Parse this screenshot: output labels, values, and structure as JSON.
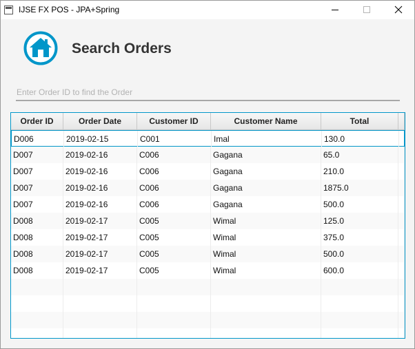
{
  "window": {
    "title": "IJSE FX POS - JPA+Spring"
  },
  "header": {
    "title": "Search Orders",
    "icon": "home-icon",
    "accent": "#0096c9"
  },
  "search": {
    "placeholder": "Enter Order ID to find the Order",
    "value": ""
  },
  "table": {
    "columns": [
      "Order ID",
      "Order Date",
      "Customer ID",
      "Customer Name",
      "Total"
    ],
    "rows": [
      [
        "D006",
        "2019-02-15",
        "C001",
        "Imal",
        "130.0"
      ],
      [
        "D007",
        "2019-02-16",
        "C006",
        "Gagana",
        "65.0"
      ],
      [
        "D007",
        "2019-02-16",
        "C006",
        "Gagana",
        "210.0"
      ],
      [
        "D007",
        "2019-02-16",
        "C006",
        "Gagana",
        "1875.0"
      ],
      [
        "D007",
        "2019-02-16",
        "C006",
        "Gagana",
        "500.0"
      ],
      [
        "D008",
        "2019-02-17",
        "C005",
        "Wimal",
        "125.0"
      ],
      [
        "D008",
        "2019-02-17",
        "C005",
        "Wimal",
        "375.0"
      ],
      [
        "D008",
        "2019-02-17",
        "C005",
        "Wimal",
        "500.0"
      ],
      [
        "D008",
        "2019-02-17",
        "C005",
        "Wimal",
        "600.0"
      ]
    ],
    "empty_row_count": 4,
    "selected_row": 0
  }
}
